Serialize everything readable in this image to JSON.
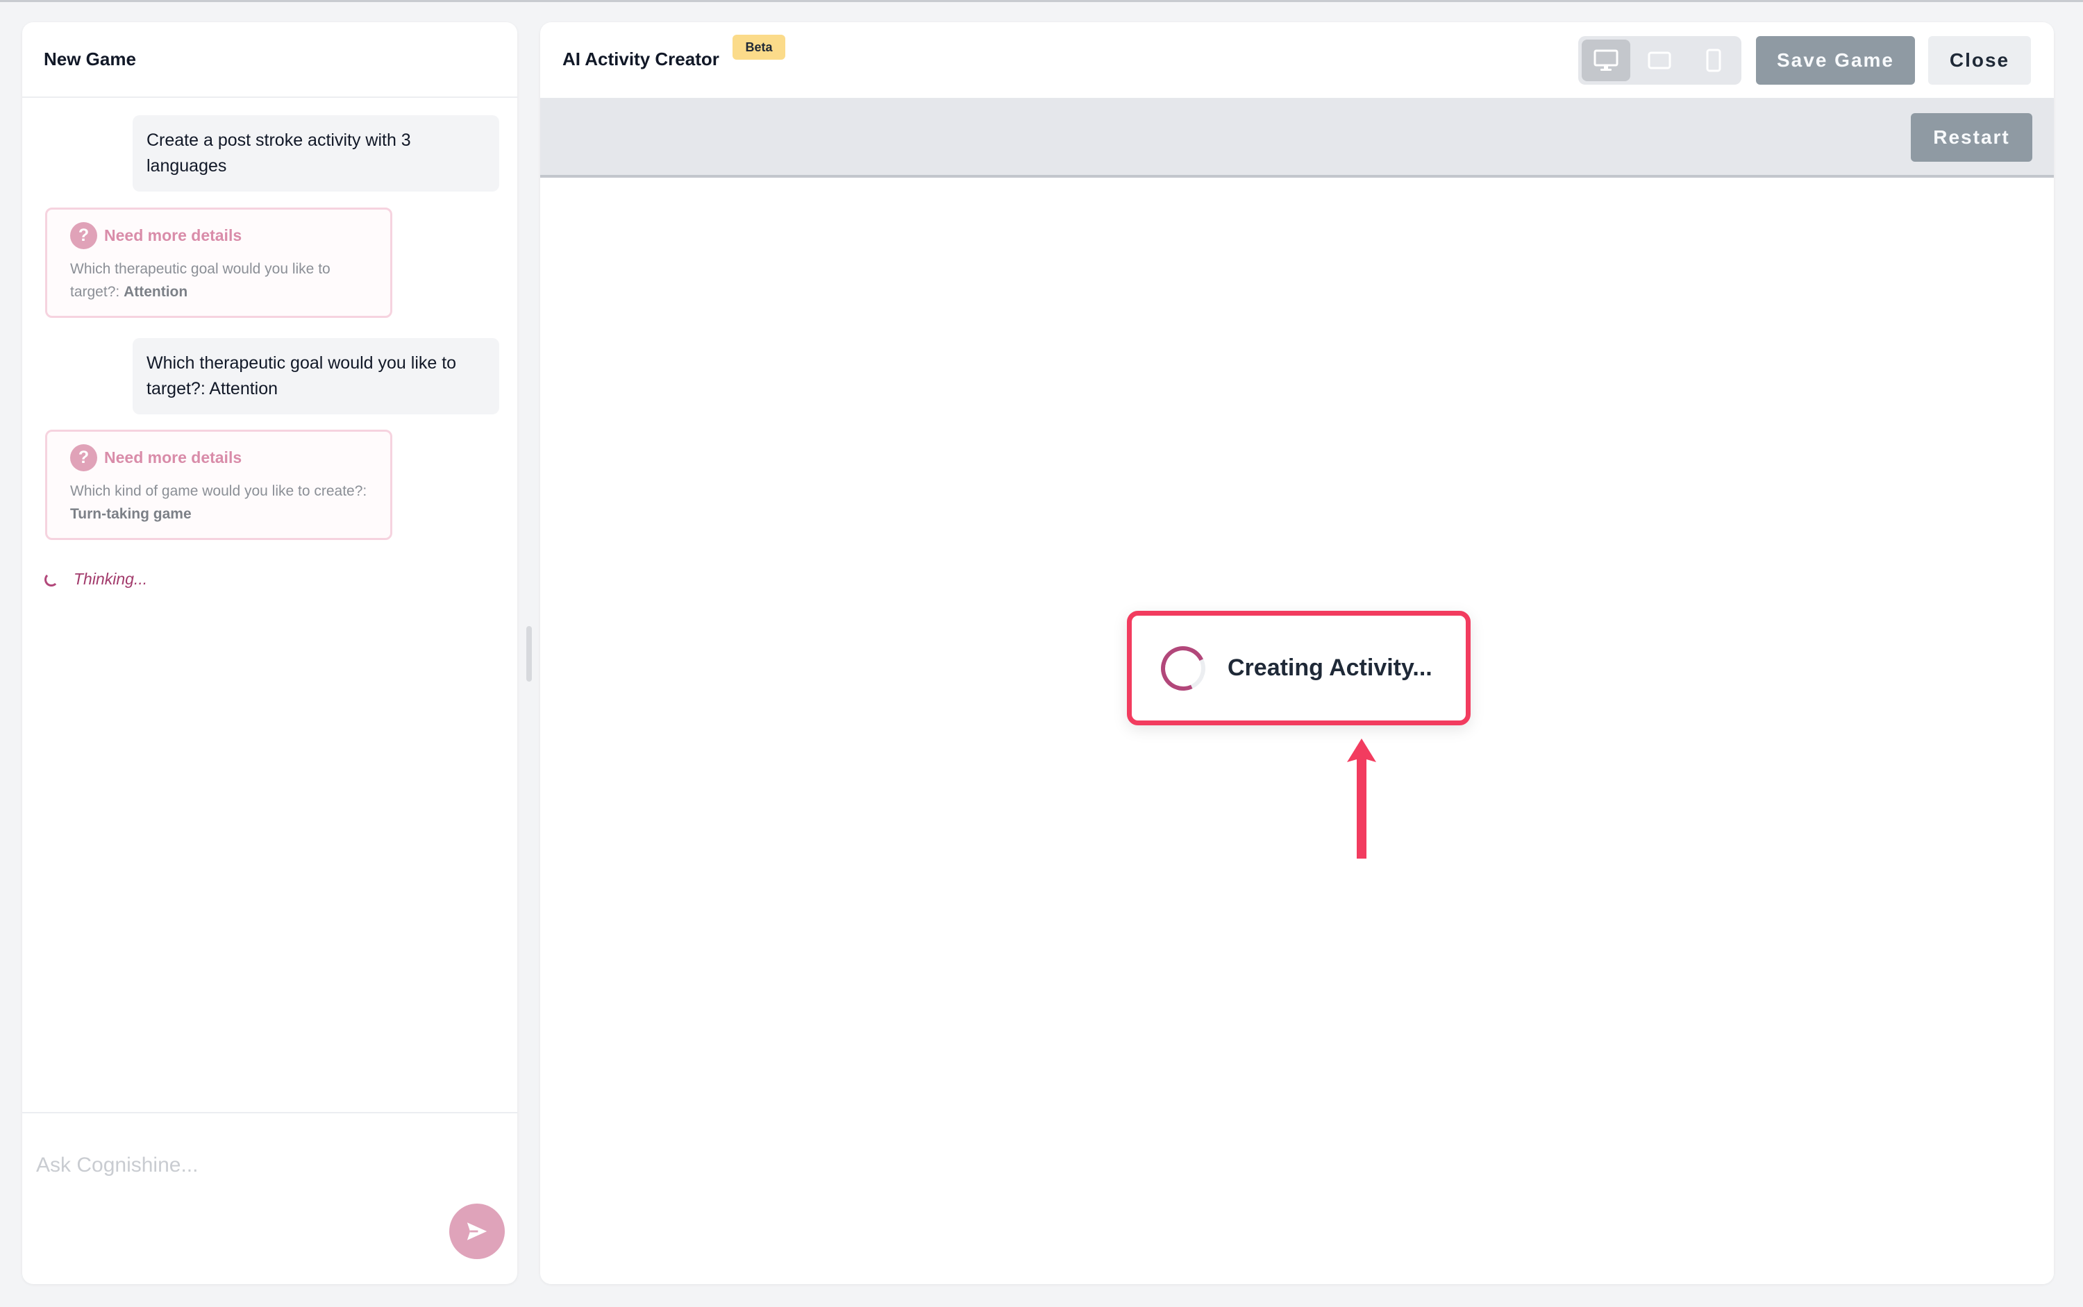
{
  "chat": {
    "title": "New Game",
    "messages": [
      {
        "role": "user",
        "text": "Create a post stroke activity with 3 languages"
      },
      {
        "role": "assistant",
        "title": "Need more details",
        "question": "Which therapeutic goal would you like to target?: ",
        "answer": "Attention"
      },
      {
        "role": "user",
        "text": "Which therapeutic goal would you like to target?: Attention"
      },
      {
        "role": "assistant",
        "title": "Need more details",
        "question": "Which kind of game would you like to create?: ",
        "answer": "Turn-taking game"
      }
    ],
    "status": "Thinking...",
    "input_placeholder": "Ask Cognishine...",
    "send_icon": "send-icon"
  },
  "editor": {
    "title": "AI Activity Creator",
    "badge": "Beta",
    "device_options": [
      "desktop-icon",
      "tablet-icon",
      "mobile-icon"
    ],
    "active_device": "desktop",
    "save_label": "Save Game",
    "close_label": "Close",
    "restart_label": "Restart",
    "loading_text": "Creating Activity..."
  },
  "colors": {
    "accent": "#b2477a",
    "highlight": "#f23c5f",
    "button_gray": "#8f9aa3",
    "send_button": "#dfa3ba"
  }
}
